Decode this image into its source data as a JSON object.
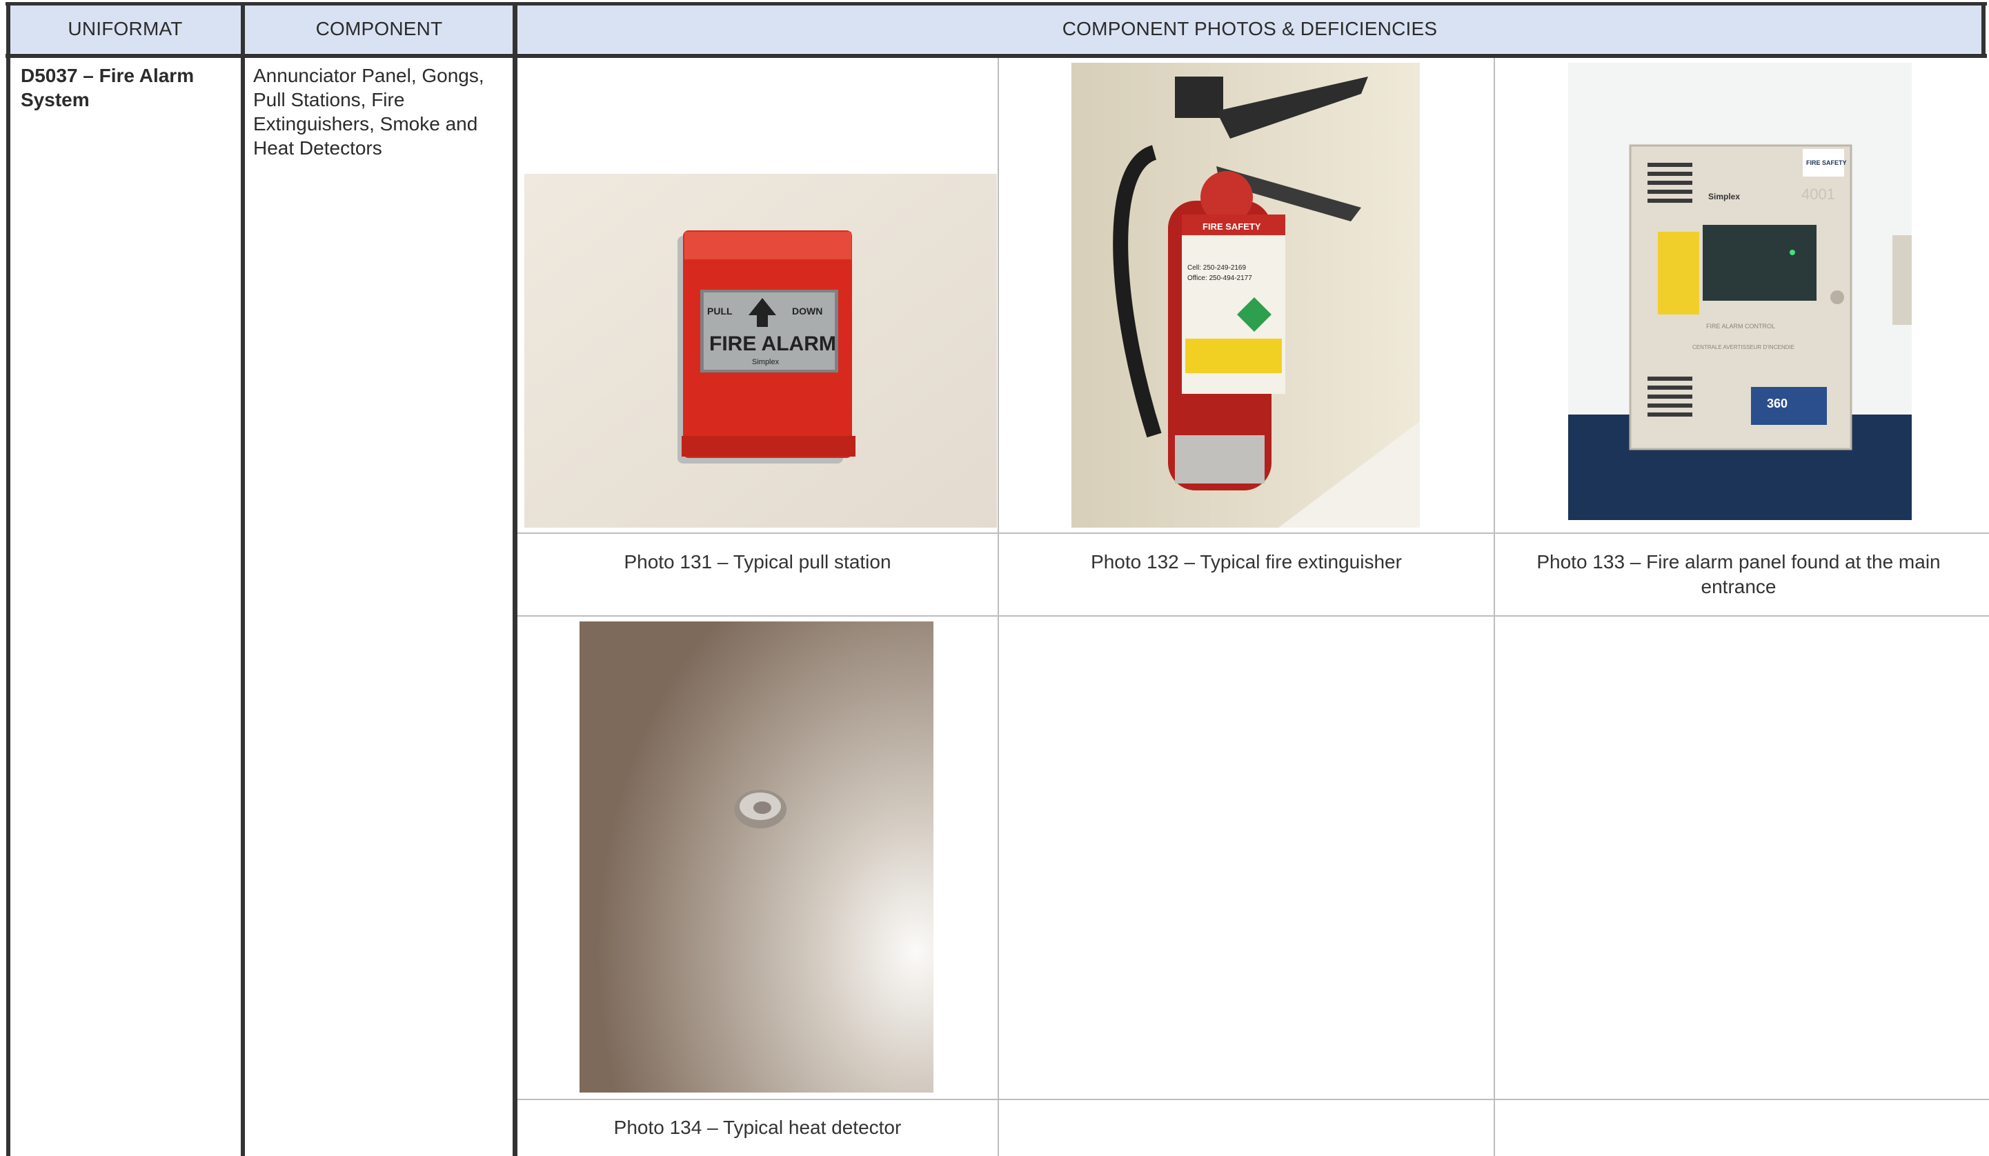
{
  "table": {
    "headers": {
      "uniformat": "UNIFORMAT",
      "component": "COMPONENT",
      "photos": "COMPONENT PHOTOS & DEFICIENCIES"
    },
    "row": {
      "uniformat": "D5037 – Fire Alarm System",
      "component": "Annunciator Panel, Gongs, Pull Stations, Fire Extinguishers, Smoke and Heat Detectors"
    },
    "photos": [
      {
        "caption": "Photo 131 – Typical pull station",
        "subject": "pull-station"
      },
      {
        "caption": "Photo 132 – Typical fire extinguisher",
        "subject": "fire-extinguisher"
      },
      {
        "caption": "Photo 133 – Fire alarm panel found at the main entrance",
        "subject": "fire-alarm-panel"
      },
      {
        "caption": "Photo 134 – Typical heat detector",
        "subject": "heat-detector"
      }
    ],
    "photo_text": {
      "pull_station": {
        "pull": "PULL",
        "down": "DOWN",
        "label": "FIRE ALARM",
        "brand": "Simplex"
      },
      "extinguisher_tag": {
        "title": "FIRE SAFETY",
        "cell": "Cell: 250-249-2169",
        "office": "Office: 250-494-2177"
      },
      "panel": {
        "brand": "Simplex",
        "model": "4001",
        "label1": "FIRE ALARM CONTROL",
        "label2": "CENTRALE AVERTISSEUR D'INCENDIE",
        "badge": "360",
        "sticker": "FIRE SAFETY"
      }
    }
  }
}
